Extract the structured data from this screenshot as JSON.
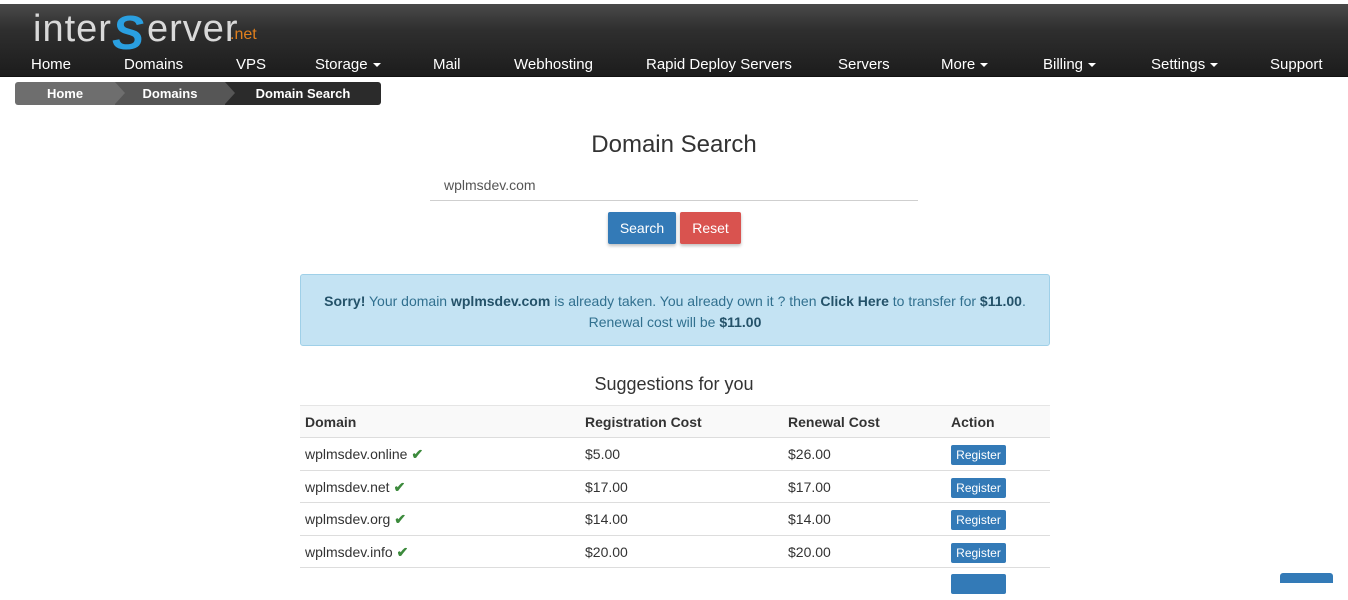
{
  "brand": {
    "part1": "inter",
    "part2": "S",
    "part3": "erver",
    "suffix": ".net"
  },
  "nav": [
    {
      "label": "Home",
      "dropdown": false
    },
    {
      "label": "Domains",
      "dropdown": false
    },
    {
      "label": "VPS",
      "dropdown": false
    },
    {
      "label": "Storage",
      "dropdown": true
    },
    {
      "label": "Mail",
      "dropdown": false
    },
    {
      "label": "Webhosting",
      "dropdown": false
    },
    {
      "label": "Rapid Deploy Servers",
      "dropdown": false
    },
    {
      "label": "Servers",
      "dropdown": false
    },
    {
      "label": "More",
      "dropdown": true
    },
    {
      "label": "Billing",
      "dropdown": true
    },
    {
      "label": "Settings",
      "dropdown": true
    },
    {
      "label": "Support",
      "dropdown": false
    }
  ],
  "breadcrumb": [
    "Home",
    "Domains",
    "Domain Search"
  ],
  "search": {
    "title": "Domain Search",
    "value": "wplmsdev.com",
    "search_label": "Search",
    "reset_label": "Reset"
  },
  "alert": {
    "sorry": "Sorry!",
    "text1": " Your domain ",
    "domain": "wplmsdev.com",
    "text2": " is already taken. You already own it ? then ",
    "link": "Click Here",
    "text3": " to transfer for ",
    "price": "$11.00",
    "text4": ".",
    "renewal_text": "Renewal cost will be ",
    "renewal_price": "$11.00"
  },
  "suggestions": {
    "title": "Suggestions for you",
    "headers": [
      "Domain",
      "Registration Cost",
      "Renewal Cost",
      "Action"
    ],
    "register_label": "Register",
    "rows": [
      {
        "domain": "wplmsdev.online",
        "reg": "$5.00",
        "renew": "$26.00"
      },
      {
        "domain": "wplmsdev.net",
        "reg": "$17.00",
        "renew": "$17.00"
      },
      {
        "domain": "wplmsdev.org",
        "reg": "$14.00",
        "renew": "$14.00"
      },
      {
        "domain": "wplmsdev.info",
        "reg": "$20.00",
        "renew": "$20.00"
      }
    ]
  },
  "colors": {
    "primary": "#337ab7",
    "danger": "#d9534f",
    "alert_bg": "#c4e3f3",
    "check": "#3c8a3c"
  }
}
